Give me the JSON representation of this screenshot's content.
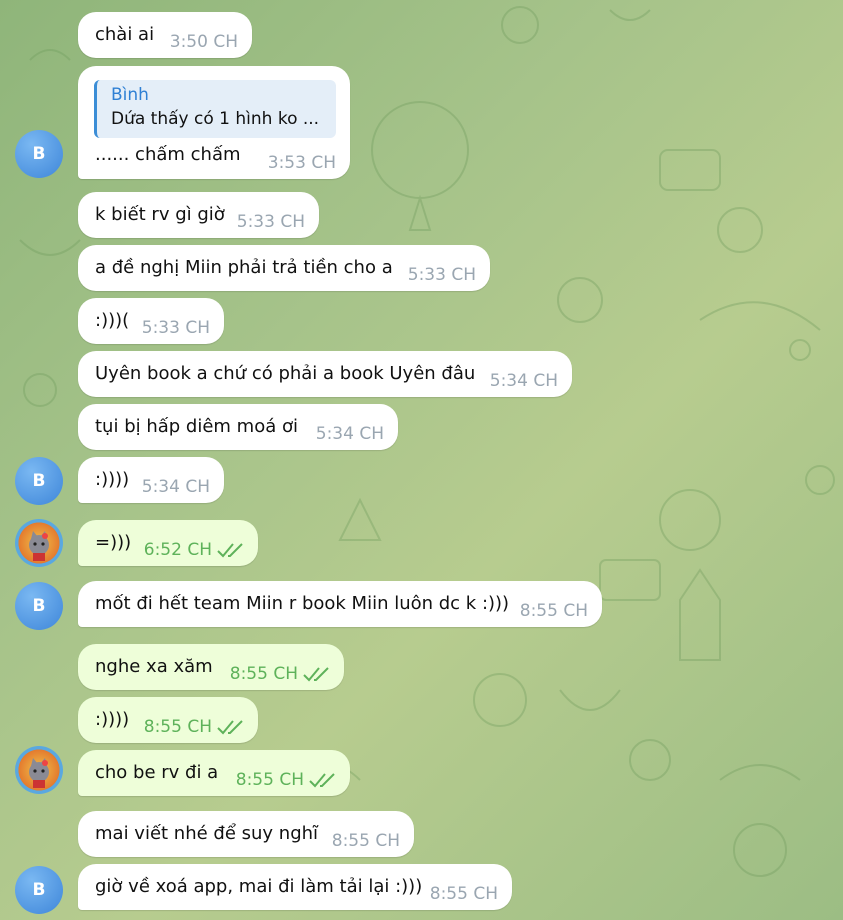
{
  "messages": [
    {
      "text": "chài ai",
      "time": "3:50 CH",
      "dir": "in"
    },
    {
      "quote_name": "Bình",
      "quote_text": "Dứa thấy có 1 hình ko ...",
      "text": "...... chấm chấm",
      "time": "3:53 CH",
      "dir": "in"
    },
    {
      "text": "k biết rv gì giờ",
      "time": "5:33 CH",
      "dir": "in"
    },
    {
      "text": "a đề nghị Miin phải trả tiền cho a",
      "time": "5:33 CH",
      "dir": "in"
    },
    {
      "text": ":)))(",
      "time": "5:33 CH",
      "dir": "in"
    },
    {
      "text": "Uyên book a chứ có phải a book Uyên đâu",
      "time": "5:34 CH",
      "dir": "in"
    },
    {
      "text": "tụi bị hấp diêm moá ơi",
      "time": "5:34 CH",
      "dir": "in"
    },
    {
      "text": ":))))",
      "time": "5:34 CH",
      "dir": "in"
    },
    {
      "text": "=)))",
      "time": "6:52 CH",
      "dir": "out"
    },
    {
      "text": "mốt đi hết team Miin r book Miin luôn dc k :)))",
      "time": "8:55 CH",
      "dir": "in"
    },
    {
      "text": "nghe xa xăm",
      "time": "8:55 CH",
      "dir": "out"
    },
    {
      "text": ":))))",
      "time": "8:55 CH",
      "dir": "out"
    },
    {
      "text": "cho be rv đi a",
      "time": "8:55 CH",
      "dir": "out"
    },
    {
      "text": "mai viết nhé để suy nghĩ",
      "time": "8:55 CH",
      "dir": "in"
    },
    {
      "text": "giờ về xoá app, mai đi làm tải lại :)))",
      "time": "8:55 CH",
      "dir": "in"
    }
  ],
  "avatars": {
    "contact_initial": "B",
    "self_avatar": "cat-sticker-avatar"
  },
  "colors": {
    "incoming_bubble": "#ffffff",
    "outgoing_bubble": "#eefed9",
    "outgoing_time": "#5eb25a",
    "avatar_blue": "#3e86d9",
    "quote_name": "#2f80d4"
  },
  "icons": [
    "double-check-icon"
  ]
}
